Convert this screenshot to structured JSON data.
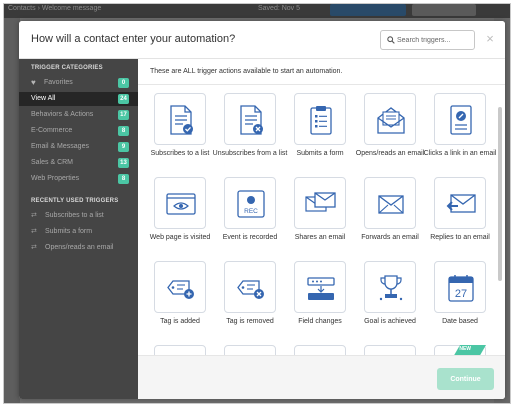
{
  "background": {
    "breadcrumb": "Contacts › Welcome message",
    "user_label": "Saved: Nov 5"
  },
  "modal": {
    "title": "How will a contact enter your automation?",
    "search": {
      "placeholder": "Search triggers...",
      "value": ""
    },
    "close_label": "×"
  },
  "sidebar": {
    "categories_header": "TRIGGER CATEGORIES",
    "items": [
      {
        "label": "Favorites",
        "count": "0",
        "icon": "heart-icon"
      },
      {
        "label": "View All",
        "count": "24",
        "active": true
      },
      {
        "label": "Behaviors & Actions",
        "count": "17"
      },
      {
        "label": "E-Commerce",
        "count": "8"
      },
      {
        "label": "Email & Messages",
        "count": "9"
      },
      {
        "label": "Sales & CRM",
        "count": "13"
      },
      {
        "label": "Web Properties",
        "count": "8"
      }
    ],
    "recent_header": "RECENTLY USED TRIGGERS",
    "recent": [
      {
        "label": "Subscribes to a list",
        "icon": "swap-icon"
      },
      {
        "label": "Submits a form",
        "icon": "swap-icon"
      },
      {
        "label": "Opens/reads an email",
        "icon": "swap-icon"
      }
    ]
  },
  "content": {
    "intro": "These are ALL trigger actions available to start an automation.",
    "tiles": [
      {
        "label": "Subscribes to a list",
        "icon": "document-check-icon"
      },
      {
        "label": "Unsubscribes from a list",
        "icon": "document-x-icon"
      },
      {
        "label": "Submits a form",
        "icon": "clipboard-form-icon"
      },
      {
        "label": "Opens/reads an email",
        "icon": "open-envelope-icon"
      },
      {
        "label": "Clicks a link in an email",
        "icon": "link-document-icon"
      },
      {
        "label": "Web page is visited",
        "icon": "browser-eye-icon"
      },
      {
        "label": "Event is recorded",
        "icon": "record-icon"
      },
      {
        "label": "Shares an email",
        "icon": "share-envelope-icon"
      },
      {
        "label": "Forwards an email",
        "icon": "forward-envelope-icon"
      },
      {
        "label": "Replies to an email",
        "icon": "reply-envelope-icon"
      },
      {
        "label": "Tag is added",
        "icon": "tag-add-icon"
      },
      {
        "label": "Tag is removed",
        "icon": "tag-remove-icon"
      },
      {
        "label": "Field changes",
        "icon": "field-change-icon"
      },
      {
        "label": "Goal is achieved",
        "icon": "trophy-icon"
      },
      {
        "label": "Date based",
        "icon": "calendar-icon"
      }
    ],
    "calendar_day": "27",
    "record_text": "REC",
    "new_badge": "NEW"
  },
  "footer": {
    "continue_label": "Continue"
  },
  "colors": {
    "accent": "#4bc6a4",
    "icon_blue": "#3566b0",
    "sidebar": "#454545",
    "sidebar_active": "#262626"
  }
}
